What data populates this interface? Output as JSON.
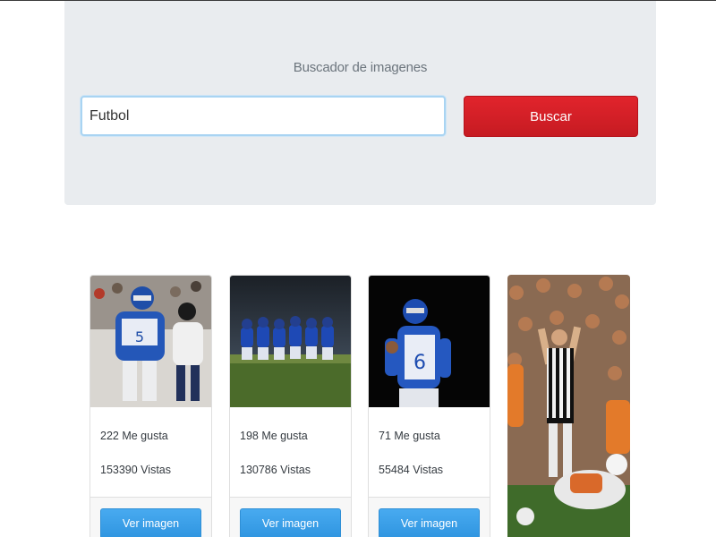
{
  "search": {
    "title": "Buscador de imagenes",
    "query": "Futbol",
    "button_label": "Buscar"
  },
  "results": [
    {
      "likes": "222 Me gusta",
      "views": "153390 Vistas",
      "button_label": "Ver imagen"
    },
    {
      "likes": "198 Me gusta",
      "views": "130786 Vistas",
      "button_label": "Ver imagen"
    },
    {
      "likes": "71 Me gusta",
      "views": "55484 Vistas",
      "button_label": "Ver imagen"
    }
  ],
  "colors": {
    "jumbotron": "#e9ecef",
    "search_button": "#d41f27",
    "view_button": "#3b9fe8"
  }
}
